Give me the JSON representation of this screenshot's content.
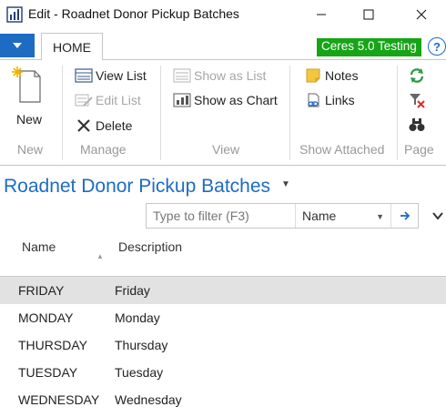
{
  "window": {
    "title": "Edit - Roadnet Donor Pickup Batches",
    "minimize": "—",
    "maximize": "☐",
    "close": "✕"
  },
  "ribbon": {
    "tab_home": "HOME",
    "company": "Ceres 5.0 Testing",
    "help": "?",
    "groups": {
      "new": {
        "label": "New",
        "new_btn": "New"
      },
      "manage": {
        "label": "Manage",
        "view_list": "View List",
        "edit_list": "Edit List",
        "delete": "Delete"
      },
      "view": {
        "label": "View",
        "show_as_list": "Show as List",
        "show_as_chart": "Show as Chart"
      },
      "show_attached": {
        "label": "Show Attached",
        "notes": "Notes",
        "links": "Links"
      },
      "page": {
        "label": "Page"
      }
    }
  },
  "page": {
    "title": "Roadnet Donor Pickup Batches"
  },
  "filter": {
    "placeholder": "Type to filter (F3)",
    "field": "Name"
  },
  "grid": {
    "columns": [
      "Name",
      "Description"
    ],
    "rows": [
      {
        "name": "FRIDAY",
        "description": "Friday",
        "selected": true
      },
      {
        "name": "MONDAY",
        "description": "Monday"
      },
      {
        "name": "THURSDAY",
        "description": "Thursday"
      },
      {
        "name": "TUESDAY",
        "description": "Tuesday"
      },
      {
        "name": "WEDNESDAY",
        "description": "Wednesday"
      }
    ]
  },
  "colors": {
    "accent": "#1e6bc4",
    "company_badge": "#16a516",
    "selected_row": "#e2e2e2"
  },
  "icons": [
    "app-icon",
    "app-menu-chevron-icon",
    "new-document-icon",
    "view-list-icon",
    "edit-list-icon",
    "delete-icon",
    "show-as-list-icon",
    "show-as-chart-icon",
    "notes-icon",
    "links-icon",
    "refresh-icon",
    "clear-filter-icon",
    "find-icon",
    "filter-go-arrow-icon",
    "collapse-chevron-icon"
  ]
}
